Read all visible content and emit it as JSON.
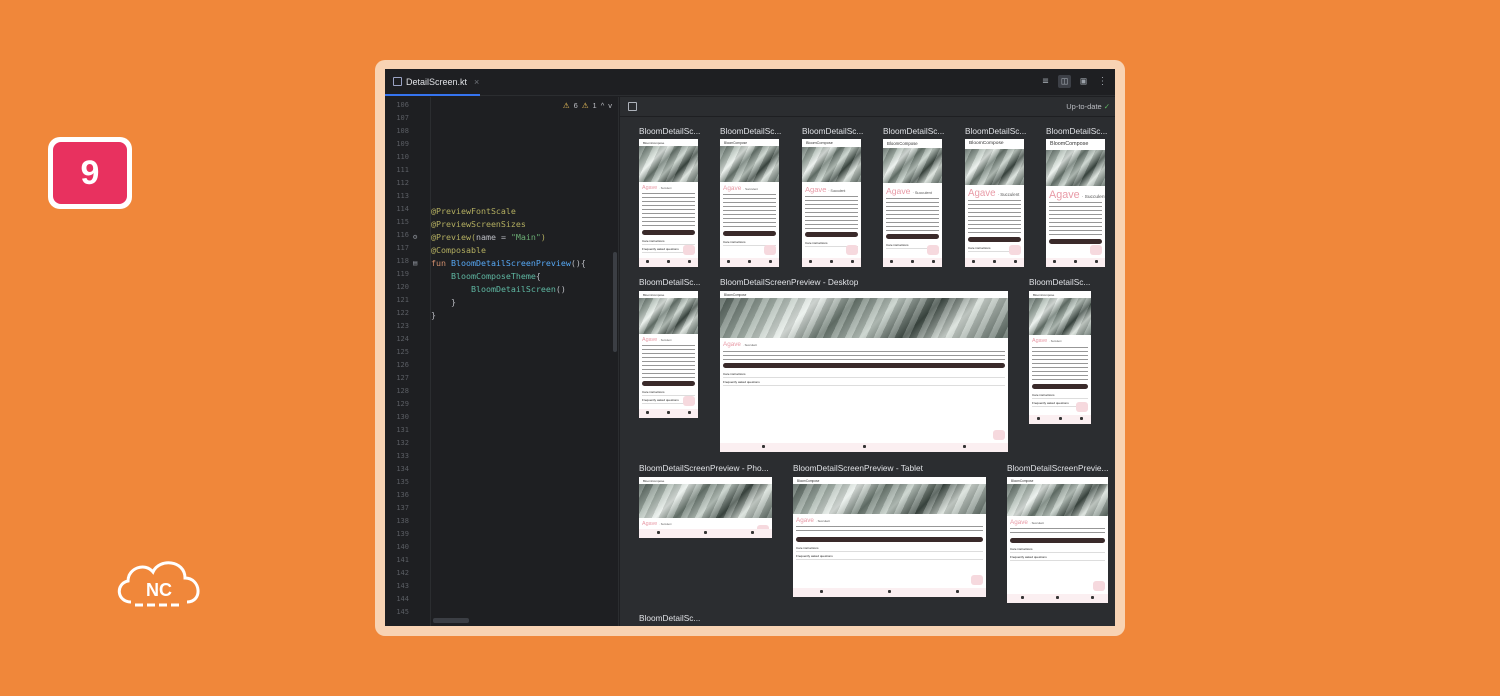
{
  "step_badge": "9",
  "logo_text": "NC",
  "tab": {
    "label": "DetailScreen.kt",
    "close": "×"
  },
  "inspections": {
    "warnings": "6",
    "weak_warnings": "1",
    "up": "^",
    "down": "v"
  },
  "preview_status": {
    "text": "Up-to-date",
    "check": "✓"
  },
  "line_numbers": [
    "106",
    "107",
    "108",
    "109",
    "110",
    "111",
    "112",
    "113",
    "114",
    "115",
    "116",
    "117",
    "118",
    "119",
    "120",
    "121",
    "122",
    "123",
    "124",
    "125",
    "126",
    "127",
    "128",
    "129",
    "130",
    "131",
    "132",
    "133",
    "134",
    "135",
    "136",
    "137",
    "138",
    "139",
    "140",
    "141",
    "142",
    "143",
    "144",
    "145"
  ],
  "code": {
    "l114": "@PreviewFontScale",
    "l115": "@PreviewScreenSizes",
    "l116_a": "@Preview(",
    "l116_b": "name = ",
    "l116_c": "\"Main\"",
    "l116_d": ")",
    "l117": "@Composable",
    "l118_kw": "fun ",
    "l118_fn": "BloomDetailScreenPreview",
    "l118_rest": "(){",
    "l119_a": "BloomComposeTheme",
    "l119_b": "{",
    "l120_a": "BloomDetailScreen",
    "l120_b": "()",
    "l121": "}",
    "l122": "}"
  },
  "previews": {
    "row1": [
      "BloomDetailSc...",
      "BloomDetailSc...",
      "BloomDetailSc...",
      "BloomDetailSc...",
      "BloomDetailSc...",
      "BloomDetailSc..."
    ],
    "row2": [
      "BloomDetailSc...",
      "BloomDetailScreenPreview - Desktop",
      "BloomDetailSc..."
    ],
    "row3": [
      "BloomDetailScreenPreview - Pho...",
      "BloomDetailScreenPreview - Tablet",
      "BloomDetailScreenPrevie..."
    ],
    "row4": [
      "BloomDetailSc..."
    ]
  },
  "card_app_title": "BloomCompose",
  "card_heading": "Agave",
  "card_subheading": "· Succulent",
  "card_body": "Lorem ipsum dolor sit amet, consectetur adipiscing elit, sed do eiusmod tempor incididunt ut labore et dolore magna aliqua. Ut enim ad minim veniam, quis nostru",
  "card_rows": {
    "care": "Care instructions",
    "faq": "Frequently asked questions"
  },
  "card_nav": [
    "Home",
    "My Plants",
    "Settings"
  ]
}
